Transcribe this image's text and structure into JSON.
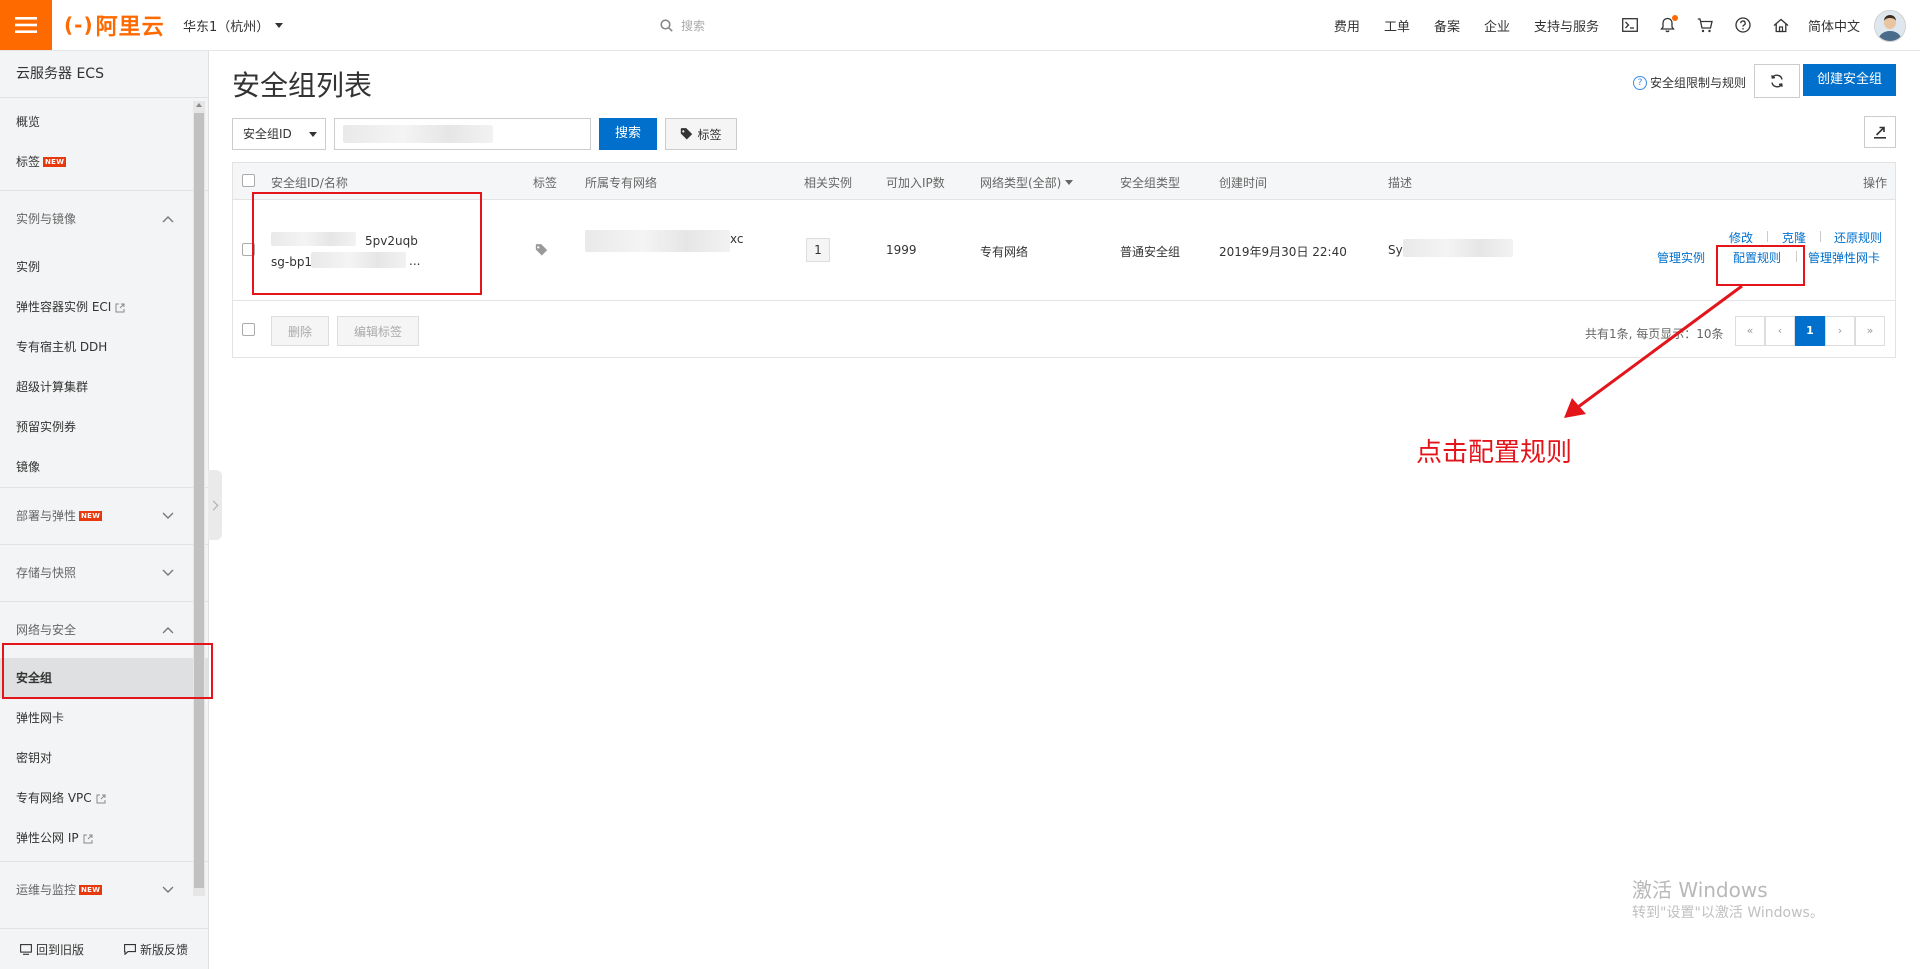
{
  "topbar": {
    "logo_text": "阿里云",
    "logo_mark": "(-)",
    "region": "华东1（杭州）",
    "search_placeholder": "搜索",
    "nav": [
      "费用",
      "工单",
      "备案",
      "企业",
      "支持与服务"
    ],
    "icons": [
      "terminal-icon",
      "bell-icon",
      "cart-icon",
      "help-icon",
      "home-icon"
    ],
    "language": "简体中文",
    "accent_color": "#ff6a00"
  },
  "sidebar": {
    "title": "云服务器 ECS",
    "top_items": [
      {
        "label": "概览"
      },
      {
        "label": "标签",
        "new": "NEW"
      }
    ],
    "groups": [
      {
        "label": "实例与镜像",
        "expanded": true,
        "items": [
          {
            "label": "实例"
          },
          {
            "label": "弹性容器实例 ECI",
            "external": true
          },
          {
            "label": "专有宿主机 DDH"
          },
          {
            "label": "超级计算集群"
          },
          {
            "label": "预留实例券"
          },
          {
            "label": "镜像"
          }
        ]
      },
      {
        "label": "部署与弹性",
        "new": "NEW",
        "expanded": false
      },
      {
        "label": "存储与快照",
        "expanded": false
      },
      {
        "label": "网络与安全",
        "expanded": true,
        "items": [
          {
            "label": "安全组",
            "active": true
          },
          {
            "label": "弹性网卡"
          },
          {
            "label": "密钥对"
          },
          {
            "label": "专有网络 VPC",
            "external": true
          },
          {
            "label": "弹性公网 IP",
            "external": true
          }
        ]
      },
      {
        "label": "运维与监控",
        "new": "NEW",
        "expanded": false
      }
    ],
    "footer": {
      "back_old": "回到旧版",
      "feedback": "新版反馈"
    }
  },
  "main": {
    "title": "安全组列表",
    "limit_link": "安全组限制与规则",
    "create_button": "创建安全组",
    "filter": {
      "field": "安全组ID",
      "value": ""
    },
    "search_button": "搜索",
    "tag_button": "标签",
    "table": {
      "columns": [
        "安全组ID/名称",
        "标签",
        "所属专有网络",
        "相关实例",
        "可加入IP数",
        "网络类型(全部)",
        "安全组类型",
        "创建时间",
        "描述",
        "操作"
      ],
      "rows": [
        {
          "name_suffix": "5pv2uqb",
          "id_prefix": "sg-bp1",
          "id_ellipsis": "...",
          "vpc_suffix": "xc",
          "instances": "1",
          "ip_count": "1999",
          "network_type": "专有网络",
          "group_type": "普通安全组",
          "created": "2019年9月30日 22:40",
          "desc_prefix": "Sy",
          "actions_row1": [
            "修改",
            "克隆",
            "还原规则"
          ],
          "actions_row2": [
            "管理实例",
            "配置规则",
            "管理弹性网卡"
          ]
        }
      ]
    },
    "bulk": {
      "delete": "删除",
      "edit_tags": "编辑标签"
    },
    "pagination": {
      "info": "共有1条, 每页显示：10条",
      "first": "«",
      "prev": "‹",
      "current": "1",
      "next": "›",
      "last": "»"
    }
  },
  "annotation": {
    "callout": "点击配置规则",
    "color": "#e4141b"
  },
  "watermark": {
    "line1": "激活 Windows",
    "line2": "转到\"设置\"以激活 Windows。"
  }
}
